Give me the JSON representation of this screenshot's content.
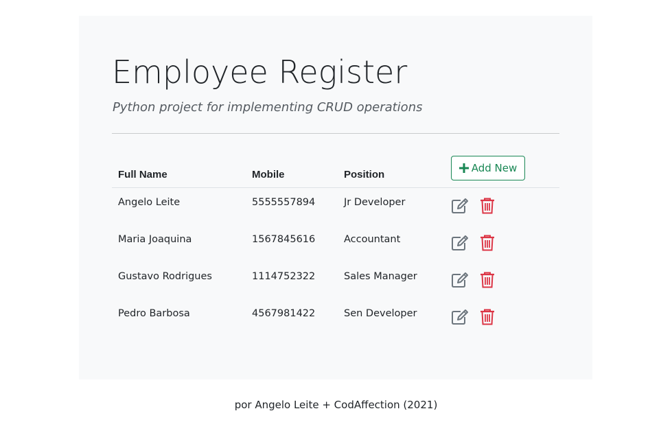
{
  "header": {
    "title": "Employee Register",
    "subtitle": "Python project for implementing CRUD operations"
  },
  "table": {
    "columns": [
      "Full Name",
      "Mobile",
      "Position"
    ],
    "add_button_label": "Add New",
    "rows": [
      {
        "full_name": "Angelo Leite",
        "mobile": "5555557894",
        "position": "Jr Developer"
      },
      {
        "full_name": "Maria Joaquina",
        "mobile": "1567845616",
        "position": "Accountant"
      },
      {
        "full_name": "Gustavo Rodrigues",
        "mobile": "1114752322",
        "position": "Sales Manager"
      },
      {
        "full_name": "Pedro Barbosa",
        "mobile": "4567981422",
        "position": "Sen Developer"
      }
    ]
  },
  "icons": {
    "add": "plus-icon",
    "edit": "edit-icon",
    "delete": "trash-icon"
  },
  "colors": {
    "success": "#198754",
    "danger": "#dc3545",
    "secondary": "#6c757d",
    "jumbotron_bg": "#f8f9fa"
  },
  "footer": {
    "text": "por Angelo Leite + CodAffection (2021)"
  }
}
